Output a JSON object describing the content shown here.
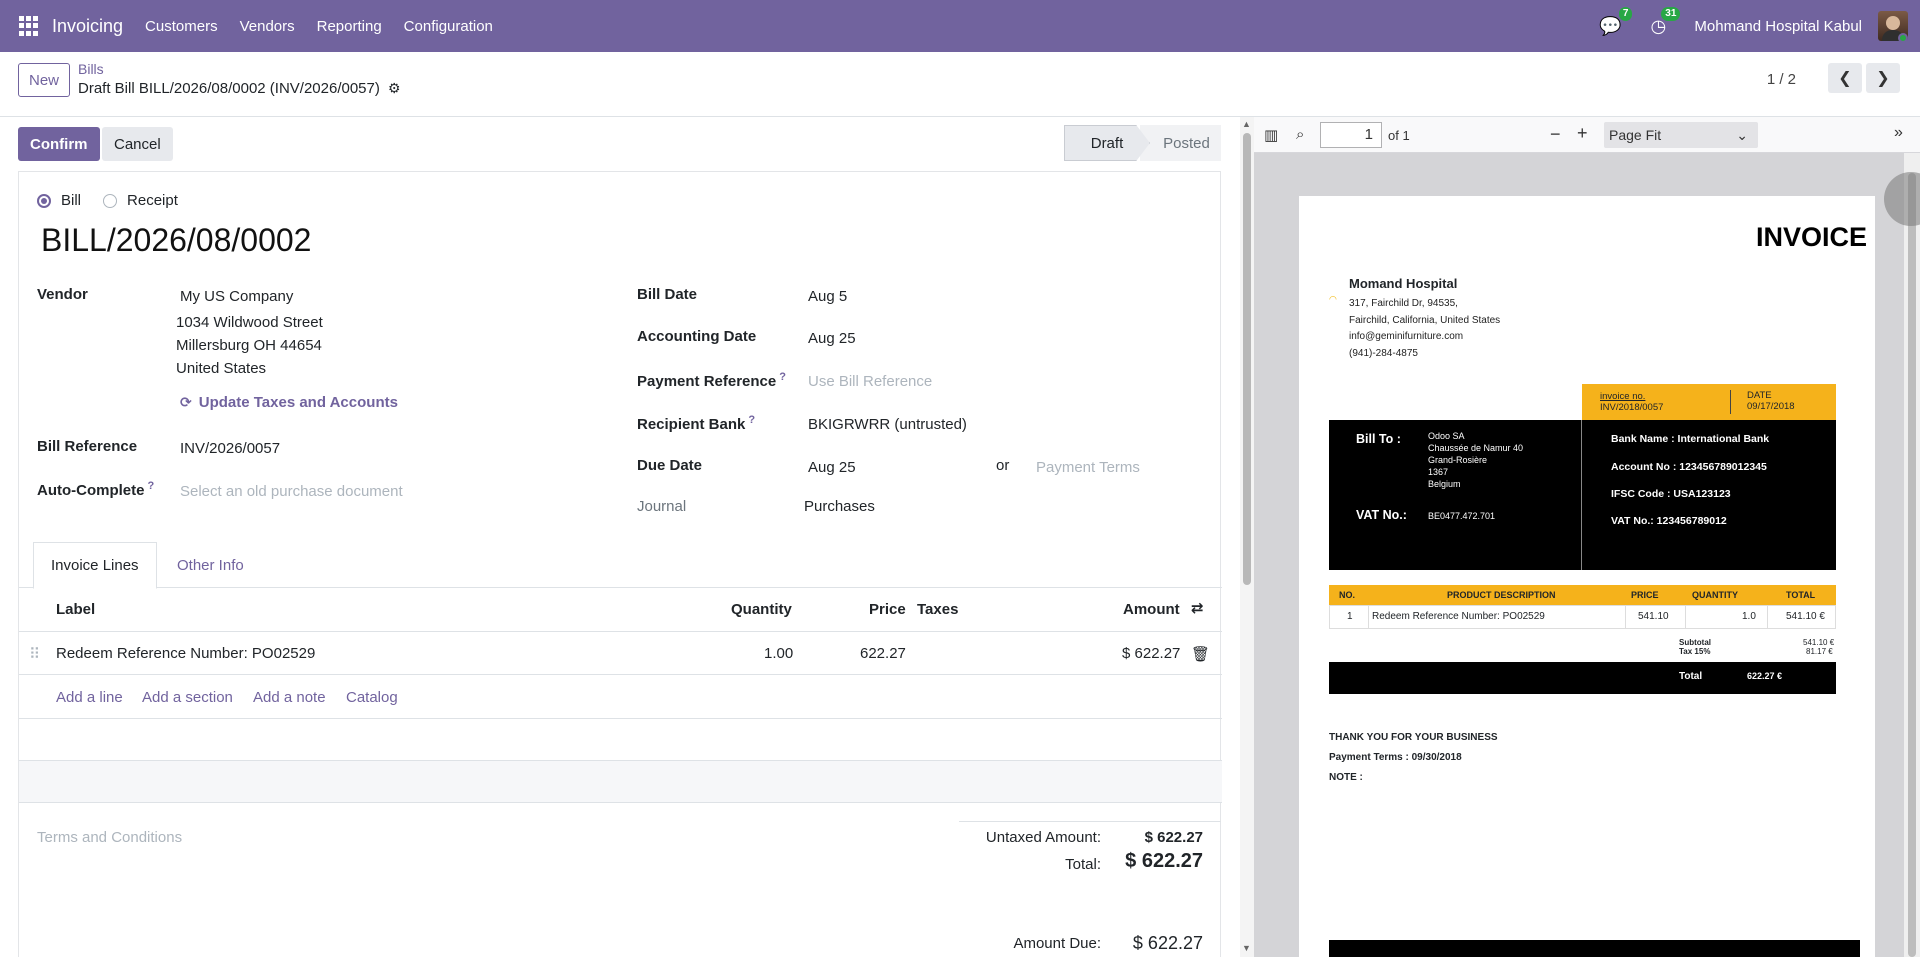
{
  "navbar": {
    "app_name": "Invoicing",
    "menu": [
      "Customers",
      "Vendors",
      "Reporting",
      "Configuration"
    ],
    "messages_count": "7",
    "activities_count": "31",
    "company": "Mohmand Hospital Kabul"
  },
  "control": {
    "new_label": "New",
    "breadcrumb": "Bills",
    "current": "Draft Bill BILL/2026/08/0002 (INV/2026/0057)",
    "pager": "1 / 2"
  },
  "status": {
    "confirm_label": "Confirm",
    "cancel_label": "Cancel",
    "stage_draft": "Draft",
    "stage_posted": "Posted"
  },
  "form": {
    "type_bill": "Bill",
    "type_receipt": "Receipt",
    "name": "BILL/2026/08/0002",
    "vendor_label": "Vendor",
    "vendor_name": "My US Company",
    "vendor_street": "1034 Wildwood Street",
    "vendor_city": "Millersburg OH 44654",
    "vendor_country": "United States",
    "update_taxes": "Update Taxes and Accounts",
    "bill_ref_label": "Bill Reference",
    "bill_ref": "INV/2026/0057",
    "autocomplete_label": "Auto-Complete",
    "autocomplete_placeholder": "Select an old purchase document",
    "bill_date_label": "Bill Date",
    "bill_date": "Aug 5",
    "accounting_date_label": "Accounting Date",
    "accounting_date": "Aug 25",
    "payment_ref_label": "Payment Reference",
    "payment_ref_placeholder": "Use Bill Reference",
    "recipient_bank_label": "Recipient Bank",
    "recipient_bank": "BKIGRWRR (untrusted)",
    "due_date_label": "Due Date",
    "due_date": "Aug 25",
    "or_label": "or",
    "payment_terms_placeholder": "Payment Terms",
    "journal_label": "Journal",
    "journal": "Purchases"
  },
  "tabs": [
    "Invoice Lines",
    "Other Info"
  ],
  "lines": {
    "headers": {
      "label": "Label",
      "quantity": "Quantity",
      "price": "Price",
      "taxes": "Taxes",
      "amount": "Amount"
    },
    "rows": [
      {
        "label": "Redeem Reference Number: PO02529",
        "quantity": "1.00",
        "price": "622.27",
        "taxes": "",
        "amount": "$ 622.27"
      }
    ],
    "add_line": "Add a line",
    "add_section": "Add a section",
    "add_note": "Add a note",
    "catalog": "Catalog"
  },
  "terms_placeholder": "Terms and Conditions",
  "totals": {
    "untaxed_label": "Untaxed Amount:",
    "untaxed": "$ 622.27",
    "total_label": "Total:",
    "total": "$ 622.27",
    "due_label": "Amount Due:",
    "due": "$ 622.27"
  },
  "pdf": {
    "page_number": "1",
    "page_of": "of 1",
    "zoom": "Page Fit",
    "invoice": {
      "title": "INVOICE",
      "company": "Momand Hospital",
      "address": [
        "317, Fairchild Dr, 94535,",
        "Fairchild, California, United States",
        "info@geminifurniture.com",
        "(941)-284-4875"
      ],
      "invoice_no_label": "invoice no.",
      "invoice_no": "INV/2018/0057",
      "date_label": "DATE",
      "date": "09/17/2018",
      "bill_to_label": "Bill To :",
      "bill_to": [
        "Odoo SA",
        "Chaussée de Namur 40",
        "Grand-Rosière",
        "1367",
        "Belgium"
      ],
      "vat_label": "VAT No.:",
      "vat": "BE0477.472.701",
      "bank_name": "Bank Name : International Bank",
      "account_no": "Account No : 123456789012345",
      "ifsc": "IFSC Code : USA123123",
      "vat_no_right": "VAT No.: 123456789012",
      "cols": {
        "no": "NO.",
        "desc": "PRODUCT DESCRIPTION",
        "price": "PRICE",
        "qty": "QUANTITY",
        "total": "TOTAL"
      },
      "item": {
        "no": "1",
        "desc": "Redeem Reference Number: PO02529",
        "price": "541.10",
        "qty": "1.0",
        "total": "541.10 €"
      },
      "subtotal_label": "Subtotal",
      "subtotal": "541.10 €",
      "tax_label": "Tax 15%",
      "tax": "81.17 €",
      "total_label": "Total",
      "total": "622.27 €",
      "thanks": "THANK YOU FOR YOUR BUSINESS",
      "payment_terms": "Payment Terms : 09/30/2018",
      "note": "NOTE :"
    }
  }
}
